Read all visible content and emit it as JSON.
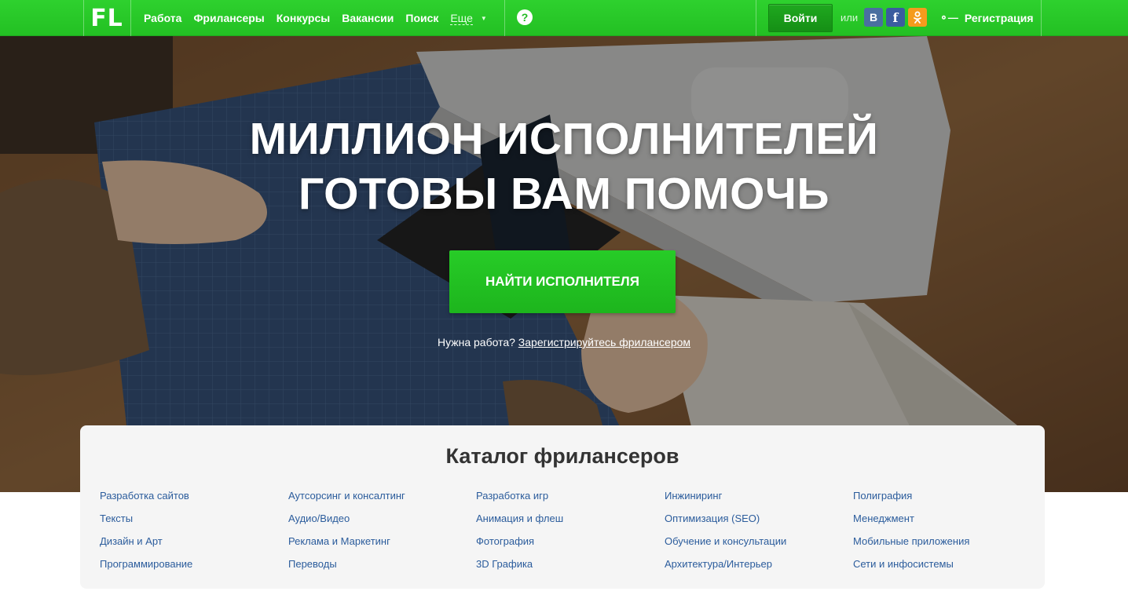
{
  "header": {
    "logo": "FL",
    "nav": [
      "Работа",
      "Фрилансеры",
      "Конкурсы",
      "Вакансии",
      "Поиск"
    ],
    "more_label": "Еще",
    "help_label": "?",
    "login_label": "Войти",
    "or_label": "или",
    "social": {
      "vk": "В",
      "fb": "f",
      "ok": "ОК"
    },
    "register_label": "Регистрация",
    "accent_color": "#22c022"
  },
  "hero": {
    "title_line1": "МИЛЛИОН ИСПОЛНИТЕЛЕЙ",
    "title_line2": "ГОТОВЫ ВАМ ПОМОЧЬ",
    "cta_label": "НАЙТИ ИСПОЛНИТЕЛЯ",
    "need_work_text": "Нужна работа?",
    "register_link": "Зарегистрируйтесь фрилансером"
  },
  "catalog": {
    "title": "Каталог фрилансеров",
    "columns": [
      [
        "Разработка сайтов",
        "Тексты",
        "Дизайн и Арт",
        "Программирование"
      ],
      [
        "Аутсорсинг и консалтинг",
        "Аудио/Видео",
        "Реклама и Маркетинг",
        "Переводы"
      ],
      [
        "Разработка игр",
        "Анимация и флеш",
        "Фотография",
        "3D Графика"
      ],
      [
        "Инжиниринг",
        "Оптимизация (SEO)",
        "Обучение и консультации",
        "Архитектура/Интерьер"
      ],
      [
        "Полиграфия",
        "Менеджмент",
        "Мобильные приложения",
        "Сети и инфосистемы"
      ]
    ]
  }
}
